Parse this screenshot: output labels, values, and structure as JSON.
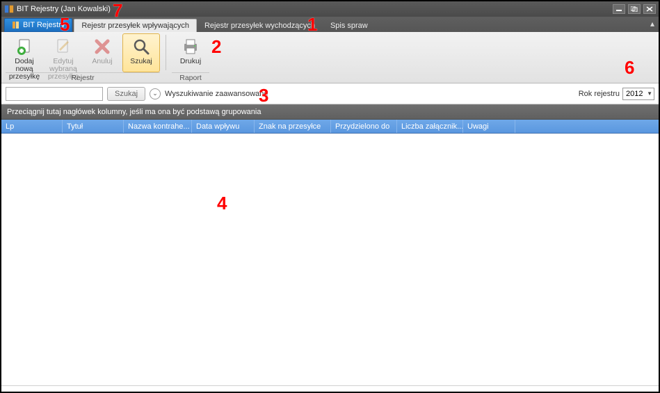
{
  "window": {
    "title": "BIT Rejestry (Jan Kowalski)"
  },
  "ribbon": {
    "tabs": [
      {
        "label": "BIT Rejestry"
      },
      {
        "label": "Rejestr przesyłek wpływających"
      },
      {
        "label": "Rejestr przesyłek wychodzących"
      },
      {
        "label": "Spis spraw"
      }
    ],
    "groups": [
      {
        "title": "Rejestr",
        "buttons": [
          {
            "label": "Dodaj nową przesyłkę",
            "icon": "plus-document-icon",
            "enabled": true
          },
          {
            "label": "Edytuj wybraną przesyłkę",
            "icon": "pencil-icon",
            "enabled": false
          },
          {
            "label": "Anuluj",
            "icon": "x-red-icon",
            "enabled": false
          },
          {
            "label": "Szukaj",
            "icon": "magnifier-icon",
            "enabled": true,
            "highlighted": true
          }
        ]
      },
      {
        "title": "Raport",
        "buttons": [
          {
            "label": "Drukuj",
            "icon": "printer-icon",
            "enabled": true
          }
        ]
      }
    ]
  },
  "search": {
    "input_value": "",
    "button_label": "Szukaj",
    "advanced_label": "Wyszukiwanie zaawansowane",
    "year_label": "Rok rejestru",
    "year_value": "2012"
  },
  "grid": {
    "group_prompt": "Przeciągnij tutaj nagłówek kolumny, jeśli ma ona być podstawą grupowania",
    "columns": [
      "Lp",
      "Tytuł",
      "Nazwa kontrahe...",
      "Data wpływu",
      "Znak na przesyłce",
      "Przydzielono do",
      "Liczba załącznik...",
      "Uwagi"
    ],
    "rows": []
  },
  "annotations": [
    "1",
    "2",
    "3",
    "4",
    "5",
    "6",
    "7"
  ],
  "colors": {
    "ribbon_accent": "#2f8fe0",
    "grid_header": "#5a97df",
    "titlebar": "#4a4a4a",
    "annotation": "#ff0000"
  }
}
